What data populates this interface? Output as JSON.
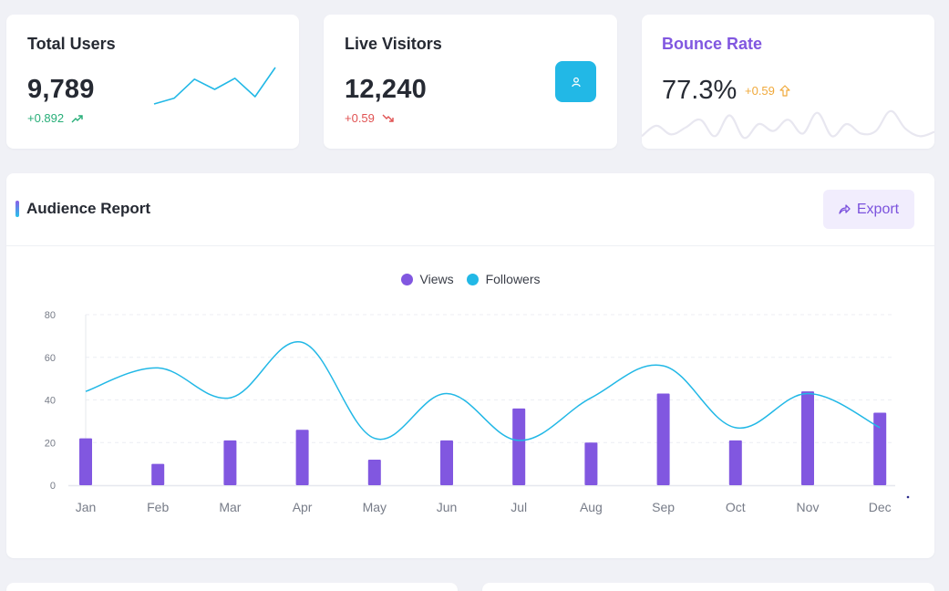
{
  "stats": {
    "total_users": {
      "title": "Total Users",
      "value": "9,789",
      "change": "+0.892",
      "trend": "up",
      "trend_icon": "trend-up-icon",
      "spark": [
        10,
        30,
        95,
        60,
        98,
        35,
        135
      ]
    },
    "live_visitors": {
      "title": "Live Visitors",
      "value": "12,240",
      "change": "+0.59",
      "trend": "down",
      "trend_icon": "trend-down-icon",
      "badge_icon": "user-icon"
    },
    "bounce_rate": {
      "title": "Bounce Rate",
      "value": "77.3%",
      "change": "+0.59",
      "change_icon": "arrow-up-icon",
      "wave": [
        6,
        18,
        8,
        16,
        25,
        6,
        30,
        4,
        20,
        12,
        25,
        9,
        33,
        6,
        20,
        9,
        12,
        35,
        15,
        6,
        11
      ]
    }
  },
  "report": {
    "title": "Audience Report",
    "export_label": "Export",
    "export_icon": "share-icon",
    "legend": [
      {
        "name": "Views",
        "color": "#8157e0"
      },
      {
        "name": "Followers",
        "color": "#22b8e6"
      }
    ]
  },
  "chart_data": {
    "type": "bar",
    "categories": [
      "Jan",
      "Feb",
      "Mar",
      "Apr",
      "May",
      "Jun",
      "Jul",
      "Aug",
      "Sep",
      "Oct",
      "Nov",
      "Dec"
    ],
    "series": [
      {
        "name": "Views",
        "type": "bar",
        "color": "#8157e0",
        "values": [
          22,
          10,
          21,
          26,
          12,
          21,
          36,
          20,
          43,
          21,
          44,
          34
        ]
      },
      {
        "name": "Followers",
        "type": "line",
        "color": "#22b8e6",
        "values": [
          44,
          55,
          41,
          67,
          22,
          43,
          21,
          41,
          56,
          27,
          43,
          27
        ]
      }
    ],
    "ylim": [
      0,
      80
    ],
    "yticks": [
      0,
      20,
      40,
      60,
      80
    ],
    "grid": true,
    "legend_position": "top-center"
  }
}
